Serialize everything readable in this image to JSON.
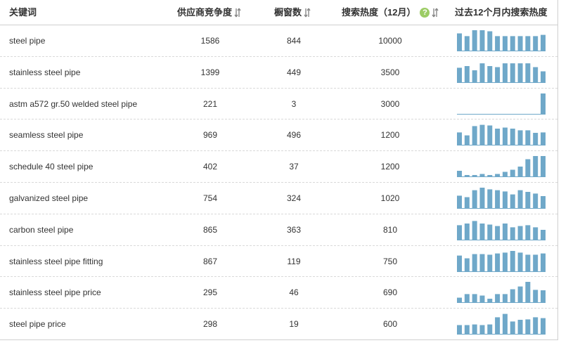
{
  "columns": {
    "keyword": "关键词",
    "supplier": "供应商竞争度",
    "showcase": "橱窗数",
    "search": "搜索热度（12月）",
    "trend": "过去12个月内搜索热度"
  },
  "help_mark": "?",
  "bar_color": "#6fa8c9",
  "rows": [
    {
      "keyword": "steel pipe",
      "supplier": "1586",
      "showcase": "844",
      "search": "10000",
      "trend": [
        0.85,
        0.72,
        1.0,
        1.0,
        0.95,
        0.72,
        0.72,
        0.72,
        0.72,
        0.72,
        0.72,
        0.78
      ]
    },
    {
      "keyword": "stainless steel pipe",
      "supplier": "1399",
      "showcase": "449",
      "search": "3500",
      "trend": [
        0.72,
        0.8,
        0.6,
        0.93,
        0.8,
        0.75,
        0.93,
        0.93,
        0.93,
        0.93,
        0.75,
        0.55
      ]
    },
    {
      "keyword": "astm a572 gr.50 welded steel pipe",
      "supplier": "221",
      "showcase": "3",
      "search": "3000",
      "trend": [
        0.0,
        0.0,
        0.0,
        0.0,
        0.0,
        0.0,
        0.0,
        0.0,
        0.0,
        0.0,
        0.0,
        1.0
      ]
    },
    {
      "keyword": "seamless steel pipe",
      "supplier": "969",
      "showcase": "496",
      "search": "1200",
      "trend": [
        0.62,
        0.48,
        0.92,
        0.98,
        0.95,
        0.8,
        0.85,
        0.8,
        0.72,
        0.72,
        0.6,
        0.62
      ]
    },
    {
      "keyword": "schedule 40 steel pipe",
      "supplier": "402",
      "showcase": "37",
      "search": "1200",
      "trend": [
        0.3,
        0.1,
        0.1,
        0.15,
        0.1,
        0.15,
        0.25,
        0.35,
        0.5,
        0.85,
        1.0,
        1.0
      ]
    },
    {
      "keyword": "galvanized steel pipe",
      "supplier": "754",
      "showcase": "324",
      "search": "1020",
      "trend": [
        0.62,
        0.55,
        0.88,
        1.0,
        0.92,
        0.88,
        0.82,
        0.68,
        0.88,
        0.8,
        0.72,
        0.6
      ]
    },
    {
      "keyword": "carbon steel pipe",
      "supplier": "865",
      "showcase": "363",
      "search": "810",
      "trend": [
        0.72,
        0.8,
        0.92,
        0.8,
        0.75,
        0.68,
        0.8,
        0.62,
        0.68,
        0.72,
        0.62,
        0.5
      ]
    },
    {
      "keyword": "stainless steel pipe fitting",
      "supplier": "867",
      "showcase": "119",
      "search": "750",
      "trend": [
        0.78,
        0.65,
        0.85,
        0.85,
        0.82,
        0.88,
        0.92,
        1.0,
        0.92,
        0.82,
        0.82,
        0.88
      ]
    },
    {
      "keyword": "stainless steel pipe price",
      "supplier": "295",
      "showcase": "46",
      "search": "690",
      "trend": [
        0.25,
        0.42,
        0.42,
        0.35,
        0.2,
        0.42,
        0.42,
        0.65,
        0.78,
        1.0,
        0.62,
        0.6
      ]
    },
    {
      "keyword": "steel pipe price",
      "supplier": "298",
      "showcase": "19",
      "search": "600",
      "trend": [
        0.45,
        0.45,
        0.48,
        0.45,
        0.48,
        0.82,
        0.98,
        0.62,
        0.7,
        0.72,
        0.82,
        0.78
      ]
    }
  ]
}
